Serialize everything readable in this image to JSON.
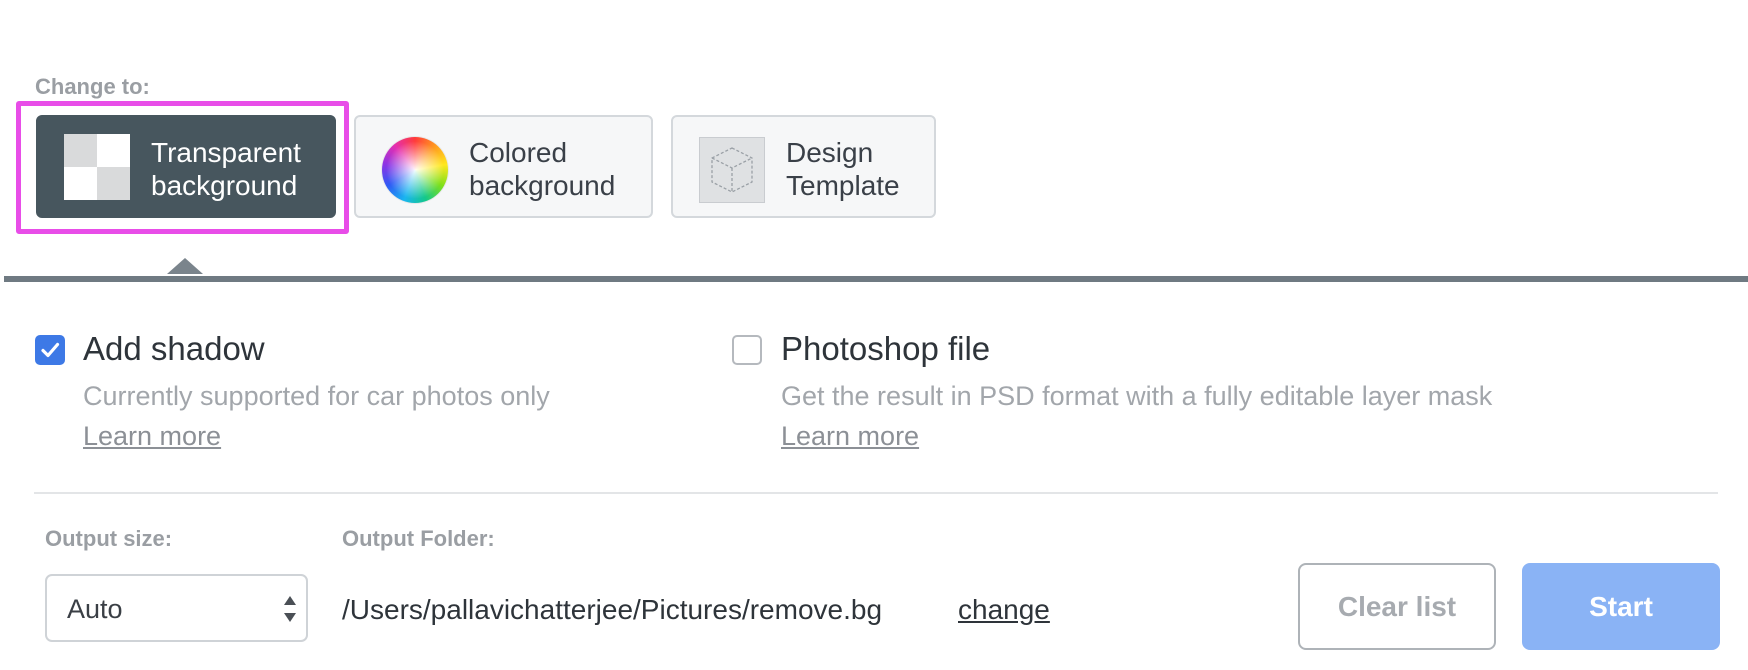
{
  "change_to": {
    "label": "Change to:",
    "options": [
      {
        "line1": "Transparent",
        "line2": "background",
        "icon": "checkerboard-icon",
        "selected": true
      },
      {
        "line1": "Colored",
        "line2": "background",
        "icon": "color-wheel-icon",
        "selected": false
      },
      {
        "line1": "Design",
        "line2": "Template",
        "icon": "cube-template-icon",
        "selected": false
      }
    ]
  },
  "add_shadow": {
    "title": "Add shadow",
    "checked": true,
    "description": "Currently supported for car photos only",
    "learn_more": "Learn more"
  },
  "photoshop_file": {
    "title": "Photoshop file",
    "checked": false,
    "description": "Get the result in PSD format with a fully editable layer mask",
    "learn_more": "Learn more"
  },
  "output": {
    "size_label": "Output size:",
    "size_value": "Auto",
    "folder_label": "Output Folder:",
    "folder_path": "/Users/pallavichatterjee/Pictures/remove.bg",
    "change_link": "change"
  },
  "buttons": {
    "clear_list": "Clear list",
    "start": "Start"
  },
  "colors": {
    "selected_option_bg": "#47565e",
    "focus_ring": "#e84de8",
    "checkbox_checked": "#3d79e6",
    "start_button": "#8ab3f5"
  }
}
